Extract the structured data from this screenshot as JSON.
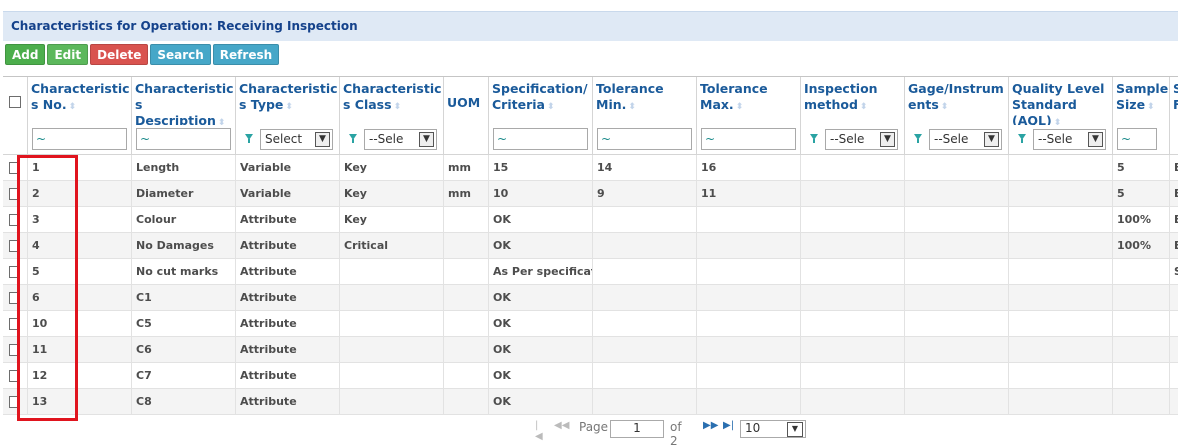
{
  "title": "Characteristics for Operation: Receiving Inspection",
  "toolbar": {
    "add": "Add",
    "edit": "Edit",
    "delete": "Delete",
    "search": "Search",
    "refresh": "Refresh"
  },
  "colors": {
    "add": "#4cae4c",
    "edit": "#5cb85c",
    "delete": "#d9534f",
    "search": "#46a7c8",
    "refresh": "#46a7c8",
    "header_text": "#1a5a9a",
    "highlight": "#e0141e"
  },
  "columns": [
    "Characteristic\ns No.",
    "Characteristic\ns Description",
    "Characteristic\ns Type",
    "Characteristic\ns Class",
    "UOM",
    "Specification/\nCriteria",
    "Tolerance\nMin.",
    "Tolerance\nMax.",
    "Inspection\nmethod",
    "Gage/Instrum\nents",
    "Quality Level\nStandard\n(AQL)",
    "Sample\nSize",
    "S\nF"
  ],
  "filters": {
    "text_tilde": "~",
    "type_select": "Select",
    "class_select": "--Sele",
    "method_select": "--Sele",
    "gage_select": "--Sele",
    "aql_select": "--Sele"
  },
  "rows": [
    [
      "1",
      "Length",
      "Variable",
      "Key",
      "mm",
      "15",
      "14",
      "16",
      "",
      "",
      "",
      "5",
      "E"
    ],
    [
      "2",
      "Diameter",
      "Variable",
      "Key",
      "mm",
      "10",
      "9",
      "11",
      "",
      "",
      "",
      "5",
      "E"
    ],
    [
      "3",
      "Colour",
      "Attribute",
      "Key",
      "",
      "OK",
      "",
      "",
      "",
      "",
      "",
      "100%",
      "E"
    ],
    [
      "4",
      "No Damages",
      "Attribute",
      "Critical",
      "",
      "OK",
      "",
      "",
      "",
      "",
      "",
      "100%",
      "E"
    ],
    [
      "5",
      "No cut marks",
      "Attribute",
      "",
      "",
      "As Per specificatio",
      "",
      "",
      "",
      "",
      "",
      "",
      "S"
    ],
    [
      "6",
      "C1",
      "Attribute",
      "",
      "",
      "OK",
      "",
      "",
      "",
      "",
      "",
      "",
      ""
    ],
    [
      "10",
      "C5",
      "Attribute",
      "",
      "",
      "OK",
      "",
      "",
      "",
      "",
      "",
      "",
      ""
    ],
    [
      "11",
      "C6",
      "Attribute",
      "",
      "",
      "OK",
      "",
      "",
      "",
      "",
      "",
      "",
      ""
    ],
    [
      "12",
      "C7",
      "Attribute",
      "",
      "",
      "OK",
      "",
      "",
      "",
      "",
      "",
      "",
      ""
    ],
    [
      "13",
      "C8",
      "Attribute",
      "",
      "",
      "OK",
      "",
      "",
      "",
      "",
      "",
      "",
      ""
    ]
  ],
  "pager": {
    "page_label": "Page",
    "page_value": "1",
    "of_label": "of 2",
    "page_size": "10"
  }
}
